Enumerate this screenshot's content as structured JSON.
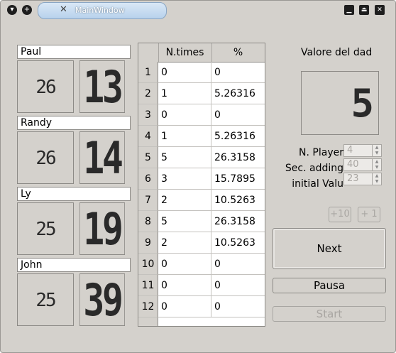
{
  "window": {
    "title": "MainWindow"
  },
  "players": [
    {
      "name": "Paul",
      "small": "26",
      "big": "13"
    },
    {
      "name": "Randy",
      "small": "26",
      "big": "14"
    },
    {
      "name": "Ly",
      "small": "25",
      "big": "19"
    },
    {
      "name": "John",
      "small": "25",
      "big": "39"
    }
  ],
  "table": {
    "headers": [
      "N.times",
      "%"
    ],
    "rows": [
      {
        "n": "1",
        "times": "0",
        "pct": "0"
      },
      {
        "n": "2",
        "times": "1",
        "pct": "5.26316"
      },
      {
        "n": "3",
        "times": "0",
        "pct": "0"
      },
      {
        "n": "4",
        "times": "1",
        "pct": "5.26316"
      },
      {
        "n": "5",
        "times": "5",
        "pct": "26.3158"
      },
      {
        "n": "6",
        "times": "3",
        "pct": "15.7895"
      },
      {
        "n": "7",
        "times": "2",
        "pct": "10.5263"
      },
      {
        "n": "8",
        "times": "5",
        "pct": "26.3158"
      },
      {
        "n": "9",
        "times": "2",
        "pct": "10.5263"
      },
      {
        "n": "10",
        "times": "0",
        "pct": "0"
      },
      {
        "n": "11",
        "times": "0",
        "pct": "0"
      },
      {
        "n": "12",
        "times": "0",
        "pct": "0"
      }
    ]
  },
  "dice": {
    "label": "Valore del dad",
    "value": "5"
  },
  "settings": {
    "players_label": "N. Player",
    "players_value": "4",
    "seconds_label": "Sec. adding",
    "seconds_value": "40",
    "initial_label": "initial Valu",
    "initial_value": "23"
  },
  "buttons": {
    "plus10": "+10",
    "plus1": "+ 1",
    "next": "Next",
    "pause": "Pausa",
    "start": "Start"
  }
}
